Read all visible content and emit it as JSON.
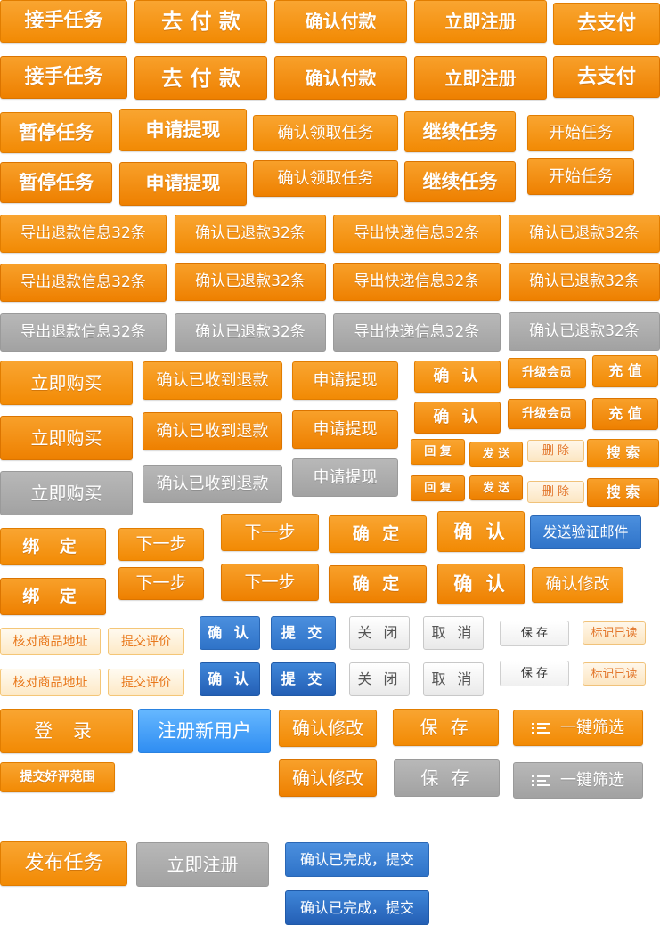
{
  "colors": {
    "orange": "#f28a04",
    "gray": "#a8a8a8",
    "blue": "#2f73c8",
    "sky_blue": "#2f8df2",
    "light_orange_text": "#e8771a"
  },
  "labels": {
    "accept_task": "接手任务",
    "go_pay": "去 付 款",
    "confirm_pay": "确认付款",
    "register_now": "立即注册",
    "go_alipay": "去支付",
    "pause_task": "暂停任务",
    "apply_withdraw": "申请提现",
    "confirm_receive_task": "确认领取任务",
    "continue_task": "继续任务",
    "start_task": "开始任务",
    "export_refund": "导出退款信息32条",
    "confirm_refunded": "确认已退款32条",
    "export_express": "导出快递信息32条",
    "buy_now": "立即购买",
    "confirm_refund_received": "确认已收到退款",
    "confirm": "确 认",
    "upgrade_member": "升级会员",
    "recharge": "充 值",
    "reply": "回 复",
    "send": "发 送",
    "delete": "删 除",
    "search": "搜 索",
    "bind": "绑 定",
    "next_step": "下一步",
    "ok": "确 定",
    "send_verify_mail": "发送验证邮件",
    "confirm_modify": "确认修改",
    "check_address": "核对商品地址",
    "submit_review": "提交评价",
    "confirm_small": "确 认",
    "submit": "提 交",
    "close": "关 闭",
    "cancel": "取 消",
    "save_small": "保 存",
    "mark_read": "标记已读",
    "login": "登 录",
    "register_user": "注册新用户",
    "save": "保 存",
    "one_key_filter": "一键筛选",
    "submit_good_range": "提交好评范围",
    "publish_task": "发布任务",
    "confirm_done_submit": "确认已完成，提交"
  }
}
